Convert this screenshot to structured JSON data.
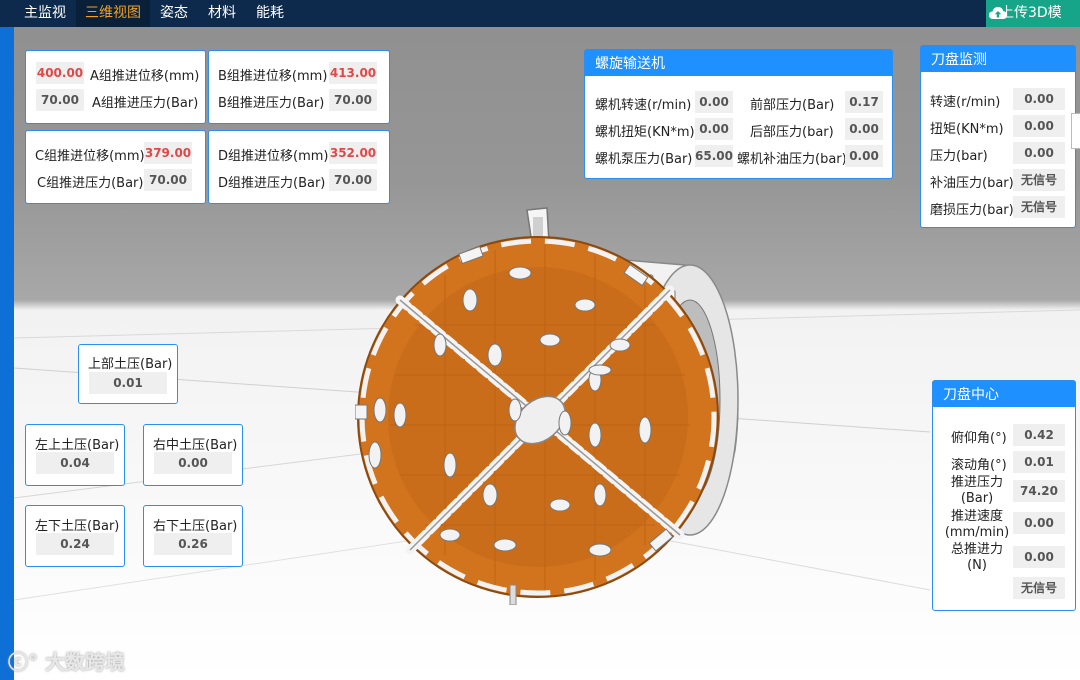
{
  "nav": {
    "tabs": [
      "主监视",
      "三维视图",
      "姿态",
      "材料",
      "能耗"
    ],
    "active": "三维视图",
    "upload_label": "上传3D模"
  },
  "thrust": {
    "A": {
      "disp_label": "A组推进位移(mm)",
      "disp": "400.00",
      "press_label": "A组推进压力(Bar)",
      "press": "70.00"
    },
    "B": {
      "disp_label": "B组推进位移(mm)",
      "disp": "413.00",
      "press_label": "B组推进压力(Bar)",
      "press": "70.00"
    },
    "C": {
      "disp_label": "C组推进位移(mm)",
      "disp": "379.00",
      "press_label": "C组推进压力(Bar)",
      "press": "70.00"
    },
    "D": {
      "disp_label": "D组推进位移(mm)",
      "disp": "352.00",
      "press_label": "D组推进压力(Bar)",
      "press": "70.00"
    }
  },
  "screw": {
    "title": "螺旋输送机",
    "speed_label": "螺机转速(r/min)",
    "speed": "0.00",
    "front_label": "前部压力(Bar)",
    "front": "0.17",
    "torque_label": "螺机扭矩(KN*m)",
    "torque": "0.00",
    "rear_label": "后部压力(bar)",
    "rear": "0.00",
    "pump_label": "螺机泵压力(Bar)",
    "pump": "65.00",
    "refill_label": "螺机补油压力(bar)",
    "refill": "0.00"
  },
  "cutter": {
    "title": "刀盘监测",
    "speed_label": "转速(r/min)",
    "speed": "0.00",
    "torque_label": "扭矩(KN*m)",
    "torque": "0.00",
    "press_label": "压力(bar)",
    "press": "0.00",
    "refill_label": "补油压力(bar)",
    "refill": "无信号",
    "wear_label": "磨损压力(bar)",
    "wear": "无信号"
  },
  "earth": {
    "top_label": "上部土压(Bar)",
    "top": "0.01",
    "ul_label": "左上土压(Bar)",
    "ul": "0.04",
    "rm_label": "右中土压(Bar)",
    "rm": "0.00",
    "ll_label": "左下土压(Bar)",
    "ll": "0.24",
    "rl_label": "右下土压(Bar)",
    "rl": "0.26"
  },
  "center": {
    "title": "刀盘中心",
    "pitch_label": "俯仰角(°)",
    "pitch": "0.42",
    "roll_label": "滚动角(°)",
    "roll": "0.01",
    "thrust_press_label1": "推进压力",
    "thrust_press_label2": "(Bar)",
    "thrust_press": "74.20",
    "speed_label1": "推进速度",
    "speed_label2": "(mm/min)",
    "speed": "0.00",
    "total_label1": "总推进力",
    "total_label2": "(N)",
    "total": "0.00",
    "extra": "无信号"
  },
  "watermark": "大数跨境",
  "colors": {
    "nav_bg": "#0d2a4c",
    "active_tab": "#f0a020",
    "panel_border": "#2a8ff0",
    "panel_head": "#1e90ff",
    "upload": "#17a589",
    "highlight": "#e04848",
    "cutterhead": "#d2731e"
  }
}
